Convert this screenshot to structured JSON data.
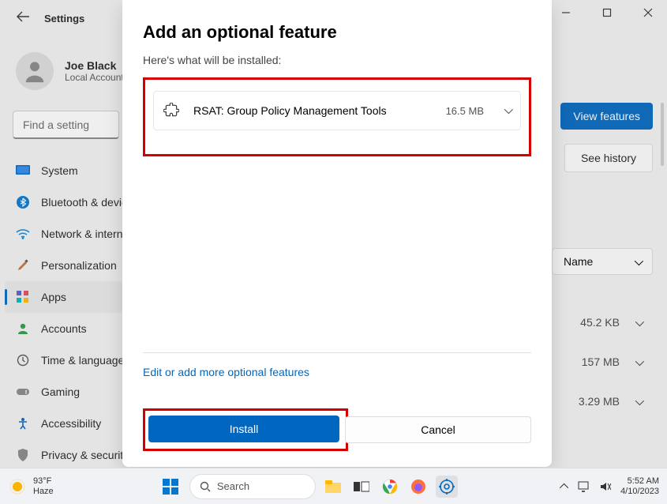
{
  "window": {
    "app_title": "Settings"
  },
  "user": {
    "name": "Joe Black",
    "account_type": "Local Account"
  },
  "search": {
    "placeholder": "Find a setting"
  },
  "sidebar": {
    "items": [
      {
        "label": "System",
        "icon": "system"
      },
      {
        "label": "Bluetooth & devices",
        "icon": "bluetooth"
      },
      {
        "label": "Network & internet",
        "icon": "wifi"
      },
      {
        "label": "Personalization",
        "icon": "brush"
      },
      {
        "label": "Apps",
        "icon": "apps",
        "active": true
      },
      {
        "label": "Accounts",
        "icon": "person"
      },
      {
        "label": "Time & language",
        "icon": "clock"
      },
      {
        "label": "Gaming",
        "icon": "gamepad"
      },
      {
        "label": "Accessibility",
        "icon": "accessibility"
      },
      {
        "label": "Privacy & security",
        "icon": "shield"
      }
    ]
  },
  "background": {
    "view_features": "View features",
    "see_history": "See history",
    "sort_label": "Name",
    "rows": [
      {
        "size": "45.2 KB"
      },
      {
        "size": "157 MB"
      },
      {
        "size": "3.29 MB"
      }
    ]
  },
  "dialog": {
    "title": "Add an optional feature",
    "subtitle": "Here's what will be installed:",
    "feature": {
      "name": "RSAT: Group Policy Management Tools",
      "size": "16.5 MB"
    },
    "edit_link": "Edit or add more optional features",
    "install": "Install",
    "cancel": "Cancel"
  },
  "taskbar": {
    "weather": {
      "temp": "93°F",
      "condition": "Haze"
    },
    "search_placeholder": "Search",
    "time": "5:52 AM",
    "date": "4/10/2023"
  }
}
